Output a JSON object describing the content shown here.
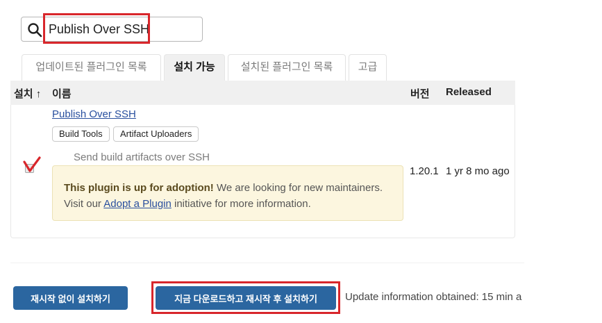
{
  "search": {
    "value": "Publish Over SSH",
    "icon": "search-icon"
  },
  "tabs": [
    {
      "label": "업데이트된 플러그인 목록",
      "active": false
    },
    {
      "label": "설치 가능",
      "active": true
    },
    {
      "label": "설치된 플러그인 목록",
      "active": false
    },
    {
      "label": "고급",
      "active": false
    }
  ],
  "table": {
    "headers": {
      "install": "설치 ↑",
      "name": "이름",
      "version": "버전",
      "released": "Released"
    },
    "row": {
      "name": "Publish Over SSH",
      "tags": [
        "Build Tools",
        "Artifact Uploaders"
      ],
      "description": "Send build artifacts over SSH",
      "adoption_bold": "This plugin is up for adoption!",
      "adoption_text1": " We are looking for new maintainers. Visit our ",
      "adoption_link": "Adopt a Plugin",
      "adoption_text2": " initiative for more information.",
      "version": "1.20.1",
      "released": "1 yr 8 mo ago"
    }
  },
  "buttons": {
    "install_without_restart": "재시작 없이 설치하기",
    "download_and_install_after_restart": "지금 다운로드하고 재시작 후 설치하기"
  },
  "update_info": "Update information obtained: 15 min a",
  "colors": {
    "accent": "#2b66a0",
    "highlight": "#d8262b",
    "link": "#284f9e",
    "adoption_bg": "#fcf6df"
  }
}
